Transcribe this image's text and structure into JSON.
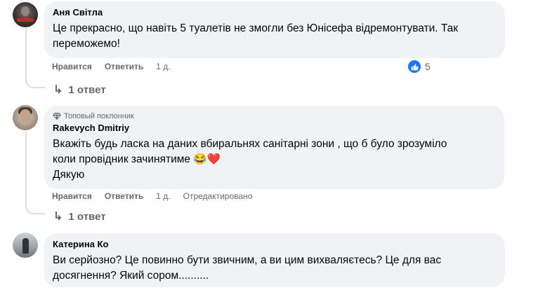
{
  "comments": [
    {
      "author": "Аня Світла",
      "lines": [
        "Це прекрасно, що навіть 5 туалетів не змогли без Юнісефа відремонтувати. Так",
        "переможемо!"
      ],
      "like_label": "Нравится",
      "reply_label": "Ответить",
      "time": "1 д.",
      "reaction_count": "5",
      "replies_label": "1 ответ"
    },
    {
      "badge": "Топовый поклонник",
      "author": "Rakevych Dmitriy",
      "lines": [
        "Вкажіть будь ласка на даних вбиральнях санітарні зони , що б було зрозуміло",
        "коли провідник зачинятиме 😂❤️",
        "Дякую"
      ],
      "like_label": "Нравится",
      "reply_label": "Ответить",
      "time": "1 д.",
      "edited": "Отредактировано",
      "replies_label": "1 ответ"
    },
    {
      "author": "Катерина Ко",
      "lines": [
        "Ви серйозно? Це повинно бути звичним, а ви цим вихваляєтесь? Це для вас",
        "досягнення? Який сором.........."
      ]
    }
  ],
  "icons": {
    "reaction": "like-icon",
    "badge": "diamond-icon",
    "reply": "reply-arrow-icon"
  },
  "colors": {
    "bubble": "#f0f2f5",
    "secondary_text": "#65676b",
    "like_blue": "#1877f2"
  }
}
